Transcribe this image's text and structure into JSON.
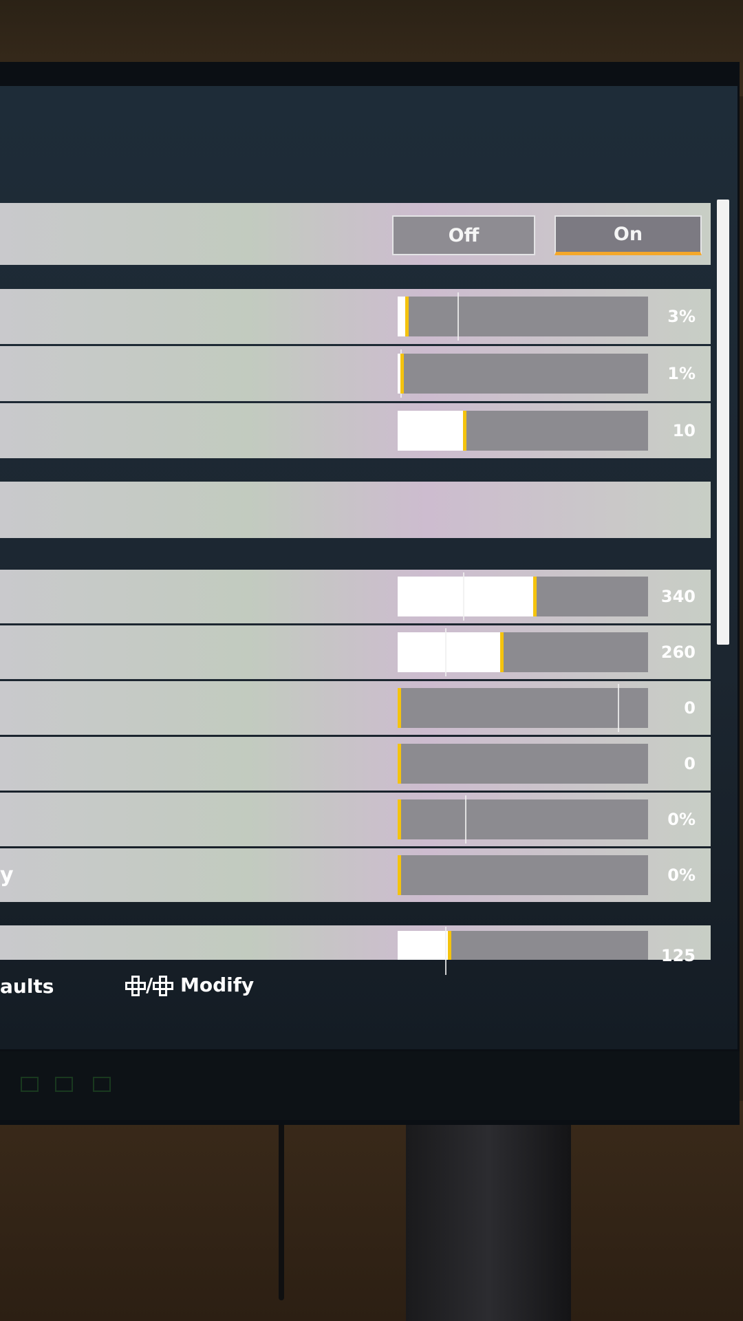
{
  "settings": {
    "toggle_row": {
      "options": [
        "Off",
        "On"
      ],
      "selected": "On"
    },
    "slider_group_1": [
      {
        "value": "3%",
        "fill": 0.03,
        "marker": 0.24
      },
      {
        "value": "1%",
        "fill": 0.01,
        "marker": 0.01
      },
      {
        "value": "10",
        "fill": 0.26,
        "marker": 0.26
      }
    ],
    "slider_group_2": [
      {
        "value": "340",
        "fill": 0.54,
        "marker": 0.26
      },
      {
        "value": "260",
        "fill": 0.41,
        "marker": 0.19
      },
      {
        "value": "0",
        "fill": 0.0,
        "marker": 0.88
      },
      {
        "value": "0",
        "fill": 0.0,
        "marker": 0.0
      },
      {
        "value": "0%",
        "fill": 0.0,
        "marker": 0.27
      },
      {
        "value": "0%",
        "fill": 0.0,
        "marker": 0.0
      }
    ],
    "slider_group_3": [
      {
        "value": "125",
        "fill": 0.2,
        "marker": 0.19
      }
    ],
    "partial_label": "y"
  },
  "footer": {
    "defaults_label": "aults",
    "modify_separator": "/",
    "modify_label": "Modify"
  },
  "colors": {
    "accent": "#f4a82a",
    "thumb": "#f4c30e"
  }
}
